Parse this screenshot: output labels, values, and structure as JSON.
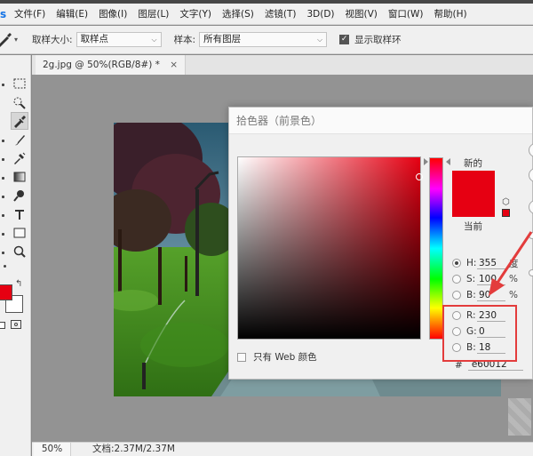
{
  "menubar": {
    "items": [
      "文件(F)",
      "编辑(E)",
      "图像(I)",
      "图层(L)",
      "文字(Y)",
      "选择(S)",
      "滤镜(T)",
      "3D(D)",
      "视图(V)",
      "窗口(W)",
      "帮助(H)"
    ]
  },
  "options": {
    "sample_size_label": "取样大小:",
    "sample_size_value": "取样点",
    "sample_label": "样本:",
    "sample_value": "所有图层",
    "show_ring_label": "显示取样环"
  },
  "document": {
    "tab_title": "2g.jpg @ 50%(RGB/8#) *",
    "close_glyph": "×"
  },
  "status": {
    "zoom": "50%",
    "doc_info": "文档:2.37M/2.37M"
  },
  "picker": {
    "title": "拾色器（前景色）",
    "new_label": "新的",
    "current_label": "当前",
    "new_color": "#e60012",
    "current_color": "#e60012",
    "web_only_label": "只有 Web 颜色",
    "fields": {
      "h": {
        "label": "H:",
        "value": "355",
        "unit": "度"
      },
      "s": {
        "label": "S:",
        "value": "100",
        "unit": "%"
      },
      "b_hsb": {
        "label": "B:",
        "value": "90",
        "unit": "%"
      },
      "r": {
        "label": "R:",
        "value": "230"
      },
      "g": {
        "label": "G:",
        "value": "0"
      },
      "b_rgb": {
        "label": "B:",
        "value": "18"
      }
    },
    "hex_hash": "#",
    "hex_value": "e60012"
  },
  "colors": {
    "foreground": "#e60012",
    "background": "#ffffff",
    "annotation": "#e33c3c"
  }
}
